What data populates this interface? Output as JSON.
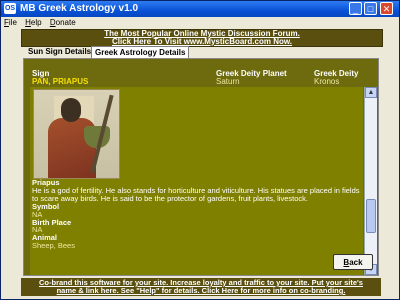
{
  "window": {
    "icon_text": "OS",
    "title": "MB Greek Astrology v1.0",
    "buttons": {
      "minimize": "_",
      "maximize": "□",
      "close": "✕"
    }
  },
  "menu": [
    "File",
    "Help",
    "Donate"
  ],
  "banner": {
    "line1": "The Most Popular Online Mystic Discussion Forum.",
    "line2": "Click Here To Visit www.MysticBoard.com Now."
  },
  "tabs": [
    {
      "label": "Sun Sign Details",
      "active": false
    },
    {
      "label": "Greek Astrology Details",
      "active": true
    }
  ],
  "details": {
    "sign_label": "Sign",
    "sign_value": "PAN, PRIAPUS",
    "planet_label": "Greek Deity Planet",
    "planet_value": "Saturn",
    "deity_label": "Greek Deity",
    "deity_value": "Kronos",
    "image_alt": "Priapus",
    "name": "Priapus",
    "description": "He is a god of fertility. He also stands for horticulture and viticulture. His statues are placed in fields to scare away birds. He is said to be the protector of gardens, fruit plants, livestock.",
    "symbol_label": "Symbol",
    "symbol_value": "NA",
    "birth_place_label": "Birth Place",
    "birth_place_value": "NA",
    "animal_label": "Animal",
    "animal_value": "Sheep, Bees"
  },
  "back_button": "Back",
  "footer": {
    "line1": "Co-brand this software for your site.  Increase loyalty and traffic to your site. Put your site's",
    "line2": "name & link here. See \"Help\" for details. Click Here for more info on co-branding."
  }
}
